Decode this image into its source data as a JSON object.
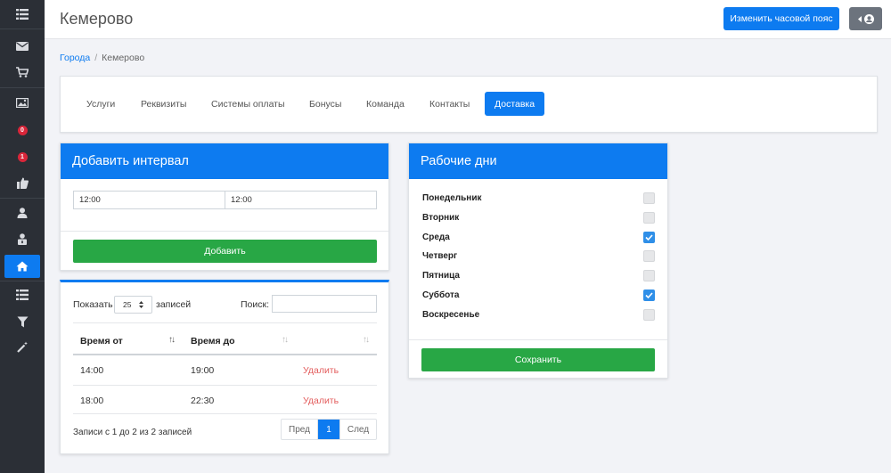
{
  "header": {
    "title": "Кемерово",
    "timezone_button": "Изменить часовой пояс",
    "user_button_icon": "user-circle-icon"
  },
  "sidebar": {
    "items": [
      {
        "icon": "list-icon"
      },
      {
        "icon": "mail-icon"
      },
      {
        "icon": "cart-icon"
      },
      {
        "icon": "image-icon"
      },
      {
        "icon": "badge-icon",
        "badge": "0"
      },
      {
        "icon": "badge-icon",
        "badge": "1"
      },
      {
        "icon": "thumbs-up-icon"
      },
      {
        "icon": "user-icon"
      },
      {
        "icon": "user-lock-icon"
      },
      {
        "icon": "home-icon",
        "active": true
      },
      {
        "icon": "list-icon"
      },
      {
        "icon": "filter-icon"
      },
      {
        "icon": "magic-wand-icon"
      }
    ]
  },
  "breadcrumb": {
    "parent": "Города",
    "separator": "/",
    "current": "Кемерово"
  },
  "tabs": [
    {
      "label": "Услуги"
    },
    {
      "label": "Реквизиты"
    },
    {
      "label": "Системы оплаты"
    },
    {
      "label": "Бонусы"
    },
    {
      "label": "Команда"
    },
    {
      "label": "Контакты"
    },
    {
      "label": "Доставка",
      "active": true
    }
  ],
  "add_interval": {
    "title": "Добавить интервал",
    "time_from": "12:00",
    "time_to": "12:00",
    "add_button": "Добавить"
  },
  "intervals_table": {
    "show_label": "Показать",
    "page_length": "25",
    "records_label": "записей",
    "search_label": "Поиск:",
    "columns": [
      "Время от",
      "Время до",
      ""
    ],
    "rows": [
      {
        "from": "14:00",
        "to": "19:00",
        "action": "Удалить"
      },
      {
        "from": "18:00",
        "to": "22:30",
        "action": "Удалить"
      }
    ],
    "info": "Записи с 1 до 2 из 2 записей",
    "pagination": {
      "prev": "Пред",
      "current": "1",
      "next": "След"
    }
  },
  "work_days": {
    "title": "Рабочие дни",
    "days": [
      {
        "name": "Понедельник",
        "checked": false
      },
      {
        "name": "Вторник",
        "checked": false
      },
      {
        "name": "Среда",
        "checked": true
      },
      {
        "name": "Четверг",
        "checked": false
      },
      {
        "name": "Пятница",
        "checked": false
      },
      {
        "name": "Суббота",
        "checked": true
      },
      {
        "name": "Воскресенье",
        "checked": false
      }
    ],
    "save_button": "Сохранить"
  },
  "colors": {
    "primary": "#0d7bf0",
    "success": "#28a745",
    "danger_link": "#e35d5d",
    "sidebar": "#2b2f36"
  }
}
